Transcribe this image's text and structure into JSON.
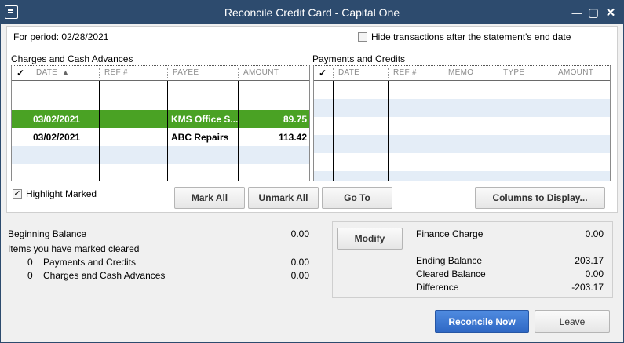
{
  "window": {
    "title": "Reconcile Credit Card - Capital One",
    "minimize": "—",
    "maximize": "▢",
    "close": "✕"
  },
  "period": {
    "label": "For period: 02/28/2021"
  },
  "hide_option": {
    "label": "Hide transactions after the statement's end date",
    "checked": false
  },
  "charges": {
    "title": "Charges and Cash Advances",
    "check_header": "✓",
    "columns": [
      "DATE",
      "REF #",
      "PAYEE",
      "AMOUNT"
    ],
    "sort_indicator": "▲",
    "rows": [
      {
        "date": "03/02/2021",
        "ref": "",
        "payee": "KMS Office S...",
        "amount": "89.75",
        "selected": true
      },
      {
        "date": "03/02/2021",
        "ref": "",
        "payee": "ABC Repairs",
        "amount": "113.42",
        "selected": false
      }
    ]
  },
  "payments": {
    "title": "Payments and Credits",
    "check_header": "✓",
    "columns": [
      "DATE",
      "REF #",
      "MEMO",
      "TYPE",
      "AMOUNT"
    ],
    "rows": []
  },
  "highlight": {
    "label": "Highlight Marked",
    "checked": true,
    "check_glyph": "✓"
  },
  "buttons": {
    "mark_all": "Mark All",
    "unmark_all": "Unmark All",
    "go_to": "Go To",
    "columns_to_display": "Columns to Display...",
    "modify": "Modify",
    "reconcile_now": "Reconcile Now",
    "leave": "Leave"
  },
  "summary": {
    "beginning_balance_label": "Beginning Balance",
    "beginning_balance": "0.00",
    "items_cleared_label": "Items you have marked cleared",
    "payments_count": "0",
    "payments_label": "Payments and Credits",
    "payments_amount": "0.00",
    "charges_count": "0",
    "charges_label": "Charges and Cash Advances",
    "charges_amount": "0.00"
  },
  "finance": {
    "finance_charge_label": "Finance Charge",
    "finance_charge": "0.00",
    "ending_balance_label": "Ending Balance",
    "ending_balance": "203.17",
    "cleared_balance_label": "Cleared Balance",
    "cleared_balance": "0.00",
    "difference_label": "Difference",
    "difference": "-203.17"
  },
  "colors": {
    "titlebar": "#2d4b6e",
    "selected_row": "#4aa224",
    "alt_row": "#e4edf7",
    "primary_button": "#2f68c4"
  }
}
